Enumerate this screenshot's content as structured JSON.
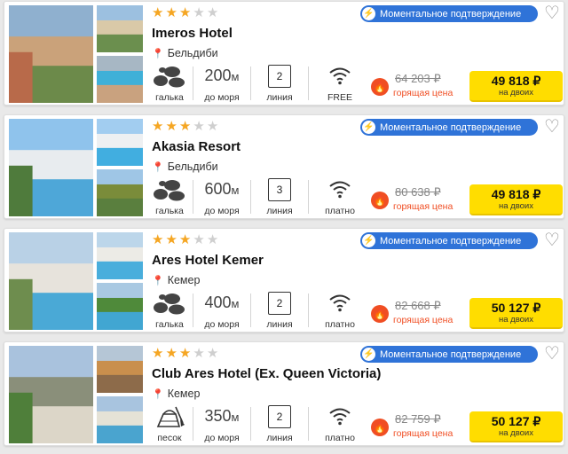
{
  "colors": {
    "badge": "#2f73d8",
    "star": "#f5a623",
    "hot": "#f04e23",
    "button": "#ffdd00"
  },
  "labels": {
    "instant_confirm": "Моментальное подтверждение",
    "hot_price": "горящая цена",
    "for_two": "на двоих",
    "to_sea": "до моря",
    "line": "линия"
  },
  "hotels": [
    {
      "name": "Imeros Hotel",
      "stars": 3,
      "location": "Бельдиби",
      "beach": "галька",
      "beach_icon": "pebbles-icon",
      "distance": "200",
      "distance_unit": "м",
      "line": "2",
      "wifi": "FREE",
      "old_price": "64 203 ₽",
      "price": "49 818 ₽"
    },
    {
      "name": "Akasia Resort",
      "stars": 3,
      "location": "Бельдиби",
      "beach": "галька",
      "beach_icon": "pebbles-icon",
      "distance": "600",
      "distance_unit": "м",
      "line": "3",
      "wifi": "платно",
      "old_price": "80 638 ₽",
      "price": "49 818 ₽"
    },
    {
      "name": "Ares Hotel Kemer",
      "stars": 3,
      "location": "Кемер",
      "beach": "галька",
      "beach_icon": "pebbles-icon",
      "distance": "400",
      "distance_unit": "м",
      "line": "2",
      "wifi": "платно",
      "old_price": "82 668 ₽",
      "price": "50 127 ₽"
    },
    {
      "name": "Club Ares Hotel (Ex. Queen Victoria)",
      "stars": 3,
      "location": "Кемер",
      "beach": "песок",
      "beach_icon": "sand-bucket-icon",
      "distance": "350",
      "distance_unit": "м",
      "line": "2",
      "wifi": "платно",
      "old_price": "82 759 ₽",
      "price": "50 127 ₽"
    }
  ]
}
